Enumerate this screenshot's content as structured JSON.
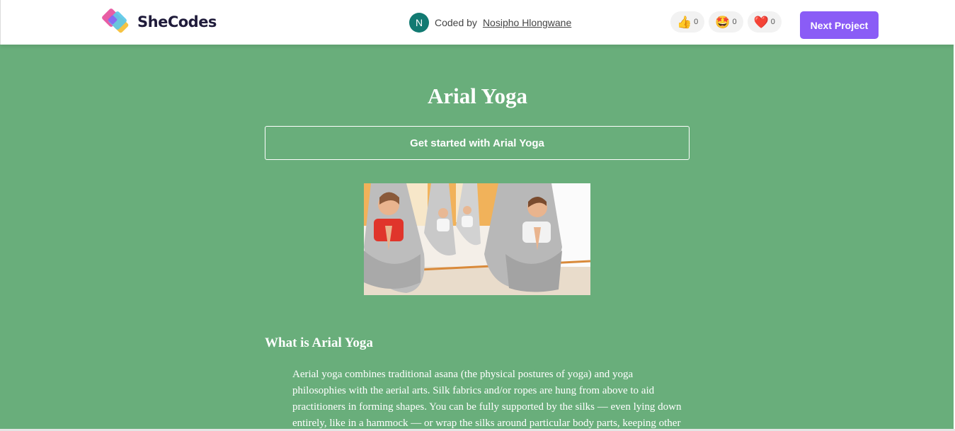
{
  "header": {
    "logo_text": "SheCodes",
    "author_initial": "N",
    "coded_by_label": "Coded by",
    "author_name": "Nosipho Hlongwane",
    "reactions": [
      {
        "icon": "thumbs-up-icon",
        "glyph": "👍",
        "count": "0"
      },
      {
        "icon": "star-struck-icon",
        "glyph": "🤩",
        "count": "0"
      },
      {
        "icon": "heart-icon",
        "glyph": "❤️",
        "count": "0"
      }
    ],
    "next_label": "Next Project",
    "accent": "#8a5cf6"
  },
  "main": {
    "background": "#69ae7b",
    "title": "Arial Yoga",
    "cta_label": "Get started with Arial Yoga",
    "section_title": "What is Arial Yoga",
    "section_body": "Aerial yoga combines traditional asana (the physical postures of yoga) and yoga philosophies with the aerial arts. Silk fabrics and/or ropes are hung from above to aid practitioners in forming shapes. You can be fully supported by the silks — even lying down entirely, like in a hammock — or wrap the silks around particular body parts, keeping other"
  }
}
